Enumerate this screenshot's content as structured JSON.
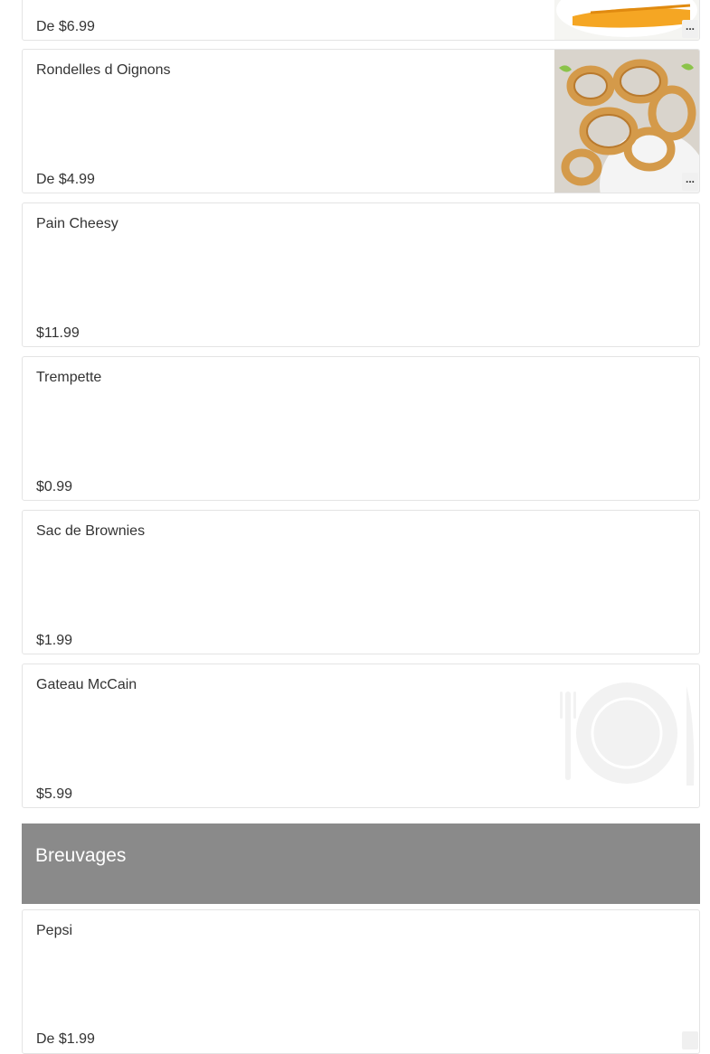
{
  "menu_items": [
    {
      "name": "",
      "price": "De $6.99",
      "image": "fries-photo"
    },
    {
      "name": "Rondelles d Oignons",
      "price": "De $4.99",
      "image": "onion-rings-photo"
    },
    {
      "name": "Pain Cheesy",
      "price": "$11.99"
    },
    {
      "name": "Trempette",
      "price": "$0.99"
    },
    {
      "name": "Sac de Brownies",
      "price": "$1.99"
    },
    {
      "name": "Gateau McCain",
      "price": "$5.99",
      "image": "plate-placeholder-icon"
    }
  ],
  "section": {
    "title": "Breuvages"
  },
  "drink_items": [
    {
      "name": "Pepsi",
      "price": "De $1.99"
    }
  ],
  "more_button_label": "...",
  "colors": {
    "section_header_bg": "#8a8a8a",
    "card_border": "#e4e4e4",
    "text": "#333333"
  }
}
